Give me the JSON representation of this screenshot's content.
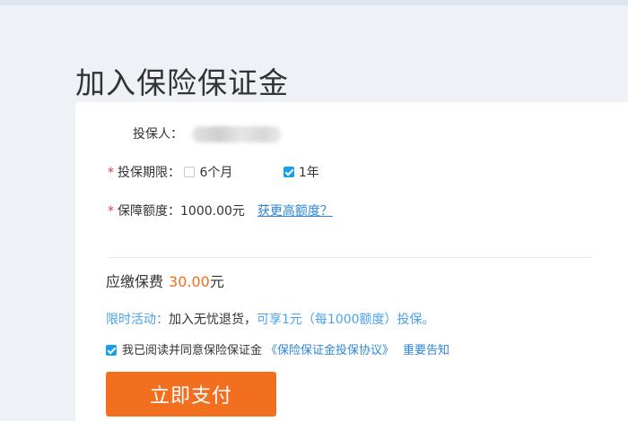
{
  "page": {
    "title": "加入保险保证金"
  },
  "form": {
    "insured": {
      "label": "投保人："
    },
    "period": {
      "required_mark": "*",
      "label": "投保期限：",
      "options": [
        {
          "label": "6个月",
          "checked": false
        },
        {
          "label": "1年",
          "checked": true
        }
      ]
    },
    "amount": {
      "required_mark": "*",
      "label": "保障额度：",
      "value": "1000.00元",
      "link": "获更高额度？"
    }
  },
  "fee": {
    "label": "应缴保费",
    "amount": "30.00",
    "unit": "元"
  },
  "promo": {
    "title": "限时活动：",
    "text_part1": "加入无忧退货，",
    "text_part2": "可享1元（每1000额度）投保。"
  },
  "agreement": {
    "checked": true,
    "text": "我已阅读并同意保险保证金",
    "link1": "《保险保证金投保协议》",
    "link2": "重要告知"
  },
  "actions": {
    "pay_label": "立即支付"
  },
  "colors": {
    "accent": "#f36f20",
    "link": "#2f86d8",
    "checkbox": "#1aa0e8",
    "required": "#e4393c"
  }
}
